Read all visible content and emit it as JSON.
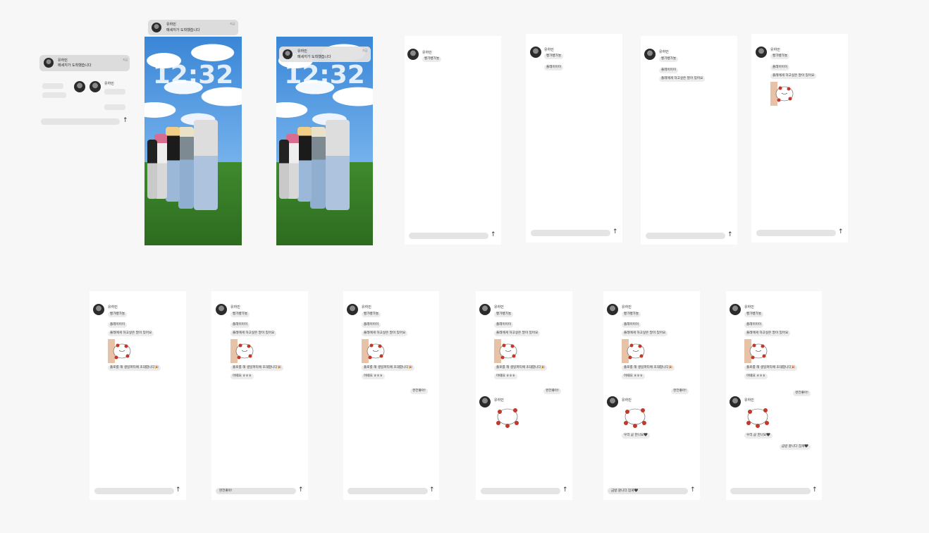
{
  "sender": "유하민",
  "notification": {
    "text": "메세지가 도착했습니다",
    "time": "지금"
  },
  "lockscreen": {
    "time": "12:32"
  },
  "messages": {
    "m1": "빵가빵가눌",
    "m2": "플레이이이",
    "m3": "플레에게 하고싶은 말이 있어요",
    "m4": "플로를 해 생일파티에 초대합니다🎉",
    "m5": "어때요 ㅎㅎㅎ",
    "reply1": "완전좋아!",
    "reply2": "우리 곧 만나요🖤",
    "reply3": "금방 갈니다 잠게🖤"
  },
  "input": {
    "draft1": "완전좋아!",
    "draft2": "금방 갈니다 잠게🖤",
    "send_icon": "arrow-up-icon"
  }
}
